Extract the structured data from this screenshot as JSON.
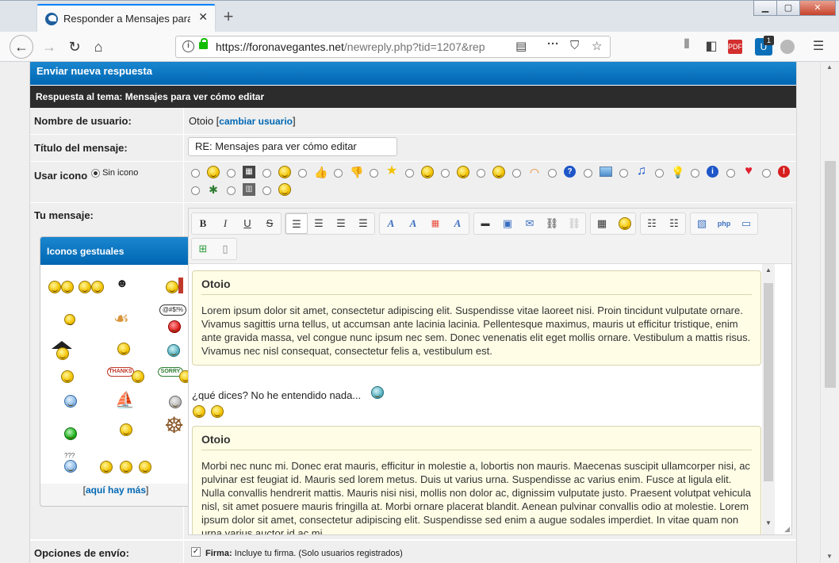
{
  "browser": {
    "tab_title": "Responder a Mensajes para ver cómo editar",
    "url_domain": "https://foronavegantes.net",
    "url_path": "/newreply.php?tid=1207&rep",
    "badge_count": "1"
  },
  "form": {
    "header": "Enviar nueva respuesta",
    "subheader": "Respuesta al tema: Mensajes para ver cómo editar",
    "username_label": "Nombre de usuario:",
    "username_value": "Otoio [",
    "change_user": "cambiar usuario",
    "username_close": "]",
    "subject_label": "Título del mensaje:",
    "subject_value": "RE: Mensajes para ver cómo editar",
    "icon_label": "Usar icono",
    "no_icon": "Sin icono",
    "message_label": "Tu mensaje:",
    "send_options_label": "Opciones de envío:",
    "signature_bold": "Firma:",
    "signature_text": "Incluye tu firma. (Solo usuarios registrados)"
  },
  "gestures": {
    "title": "Iconos gestuales",
    "more_open": "[",
    "more_link": "aquí hay más",
    "more_close": "]",
    "labels": [
      "THANKS",
      "SORRY",
      "@#$!%",
      "???"
    ]
  },
  "editor": {
    "quote1_author": "Otoio",
    "quote1_text": "Lorem ipsum dolor sit amet, consectetur adipiscing elit. Suspendisse vitae laoreet nisi. Proin tincidunt vulputate ornare. Vivamus sagittis urna tellus, ut accumsan ante lacinia lacinia. Pellentesque maximus, mauris ut efficitur tristique, enim ante gravida massa, vel congue nunc ipsum nec sem. Donec venenatis elit eget mollis ornare. Vestibulum a mattis risus. Vivamus nec nisl consequat, consectetur felis a, vestibulum est.",
    "plain_text": "¿qué dices? No he entendido nada...",
    "quote2_author": "Otoio",
    "quote2_text": "Morbi nec nunc mi. Donec erat mauris, efficitur in molestie a, lobortis non mauris. Maecenas suscipit ullamcorper nisi, ac pulvinar est feugiat id. Mauris sed lorem metus. Duis ut varius urna. Suspendisse ac varius enim. Fusce at ligula elit. Nulla convallis hendrerit mattis. Mauris nisi nisi, mollis non dolor ac, dignissim vulputate justo. Praesent volutpat vehicula nisl, sit amet posuere mauris fringilla at. Morbi ornare placerat blandit. Aenean pulvinar convallis odio at molestie. Lorem ipsum dolor sit amet, consectetur adipiscing elit. Suspendisse sed enim a augue sodales imperdiet. In vitae quam non urna varius auctor id ac mi.",
    "toolbar": {
      "bold": "B",
      "italic": "I",
      "underline": "U",
      "strike": "S"
    }
  },
  "colors": {
    "accent_blue": "#0066b3",
    "dark_header": "#2c2c2c",
    "quote_bg": "#fffde6",
    "link": "#0068b4"
  }
}
